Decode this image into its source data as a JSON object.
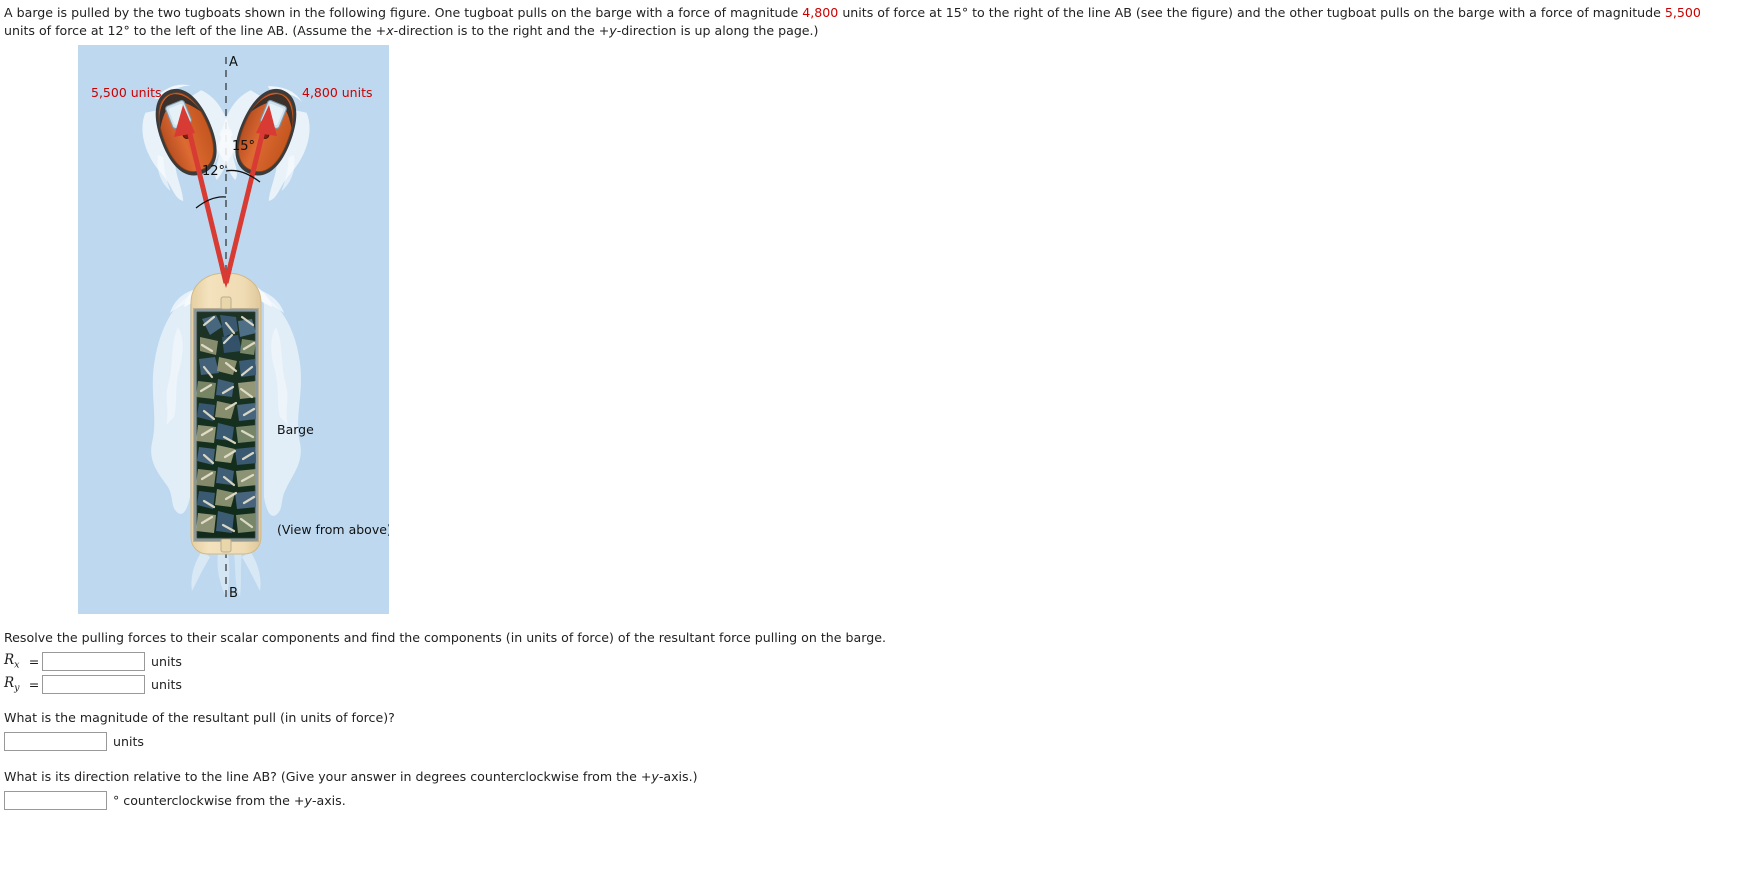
{
  "problem": {
    "line1_a": "A barge is pulled by the two tugboats shown in the following figure. One tugboat pulls on the barge with a force of magnitude ",
    "force_right": "4,800",
    "line1_b": " units of force at 15° to the right of the line AB (see the figure) and the other tugboat pulls on the barge with a force of magnitude ",
    "force_left": "5,500",
    "line2_b": " units of force at 12° to the left of the line AB. (Assume the +x-direction is to the right and the +y-direction is up along the page.)"
  },
  "figure": {
    "label_left_force": "5,500 units",
    "label_right_force": "4,800 units",
    "label_point_a": "A",
    "label_point_b": "B",
    "angle_right": "15°",
    "angle_left": "12°",
    "label_barge": "Barge",
    "label_view": "(View from above)",
    "water_color": "#bed9ef",
    "arrow_color": "#d83b33",
    "barge_hull_color": "#f0dcb4",
    "tugboat_body_color": "#d4612c"
  },
  "questions": {
    "q1_prompt": "Resolve the pulling forces to their scalar components and find the components (in units of force) of the resultant force pulling on the barge.",
    "rx_label": "R",
    "rx_sub": "x",
    "ry_label": "R",
    "ry_sub": "y",
    "equals": "=",
    "units": "units",
    "rx_value": "",
    "ry_value": "",
    "q2_prompt": "What is the magnitude of the resultant pull (in units of force)?",
    "magnitude_value": "",
    "q3_prompt_a": "What is its direction relative to the line AB? (Give your answer in degrees counterclockwise from the +",
    "q3_prompt_y": "y",
    "q3_prompt_b": "-axis.)",
    "direction_value": "",
    "direction_suffix_a": "° counterclockwise from the +",
    "direction_suffix_y": "y",
    "direction_suffix_b": "-axis."
  }
}
